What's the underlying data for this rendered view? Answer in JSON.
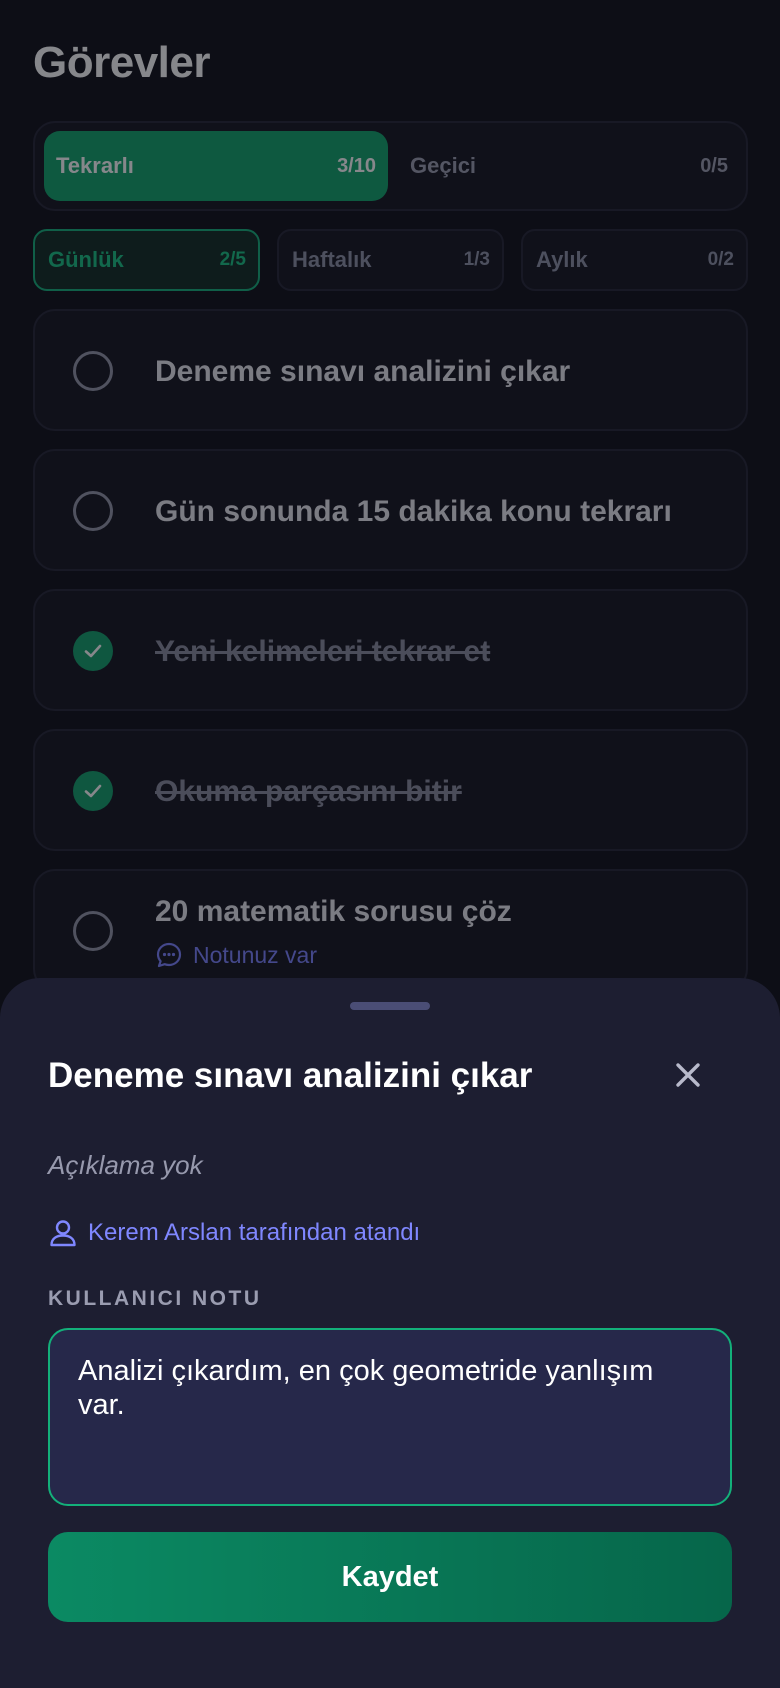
{
  "page": {
    "title": "Görevler"
  },
  "segments": [
    {
      "label": "Tekrarlı",
      "count": "3/10"
    },
    {
      "label": "Geçici",
      "count": "0/5"
    }
  ],
  "periods": [
    {
      "label": "Günlük",
      "count": "2/5"
    },
    {
      "label": "Haftalık",
      "count": "1/3"
    },
    {
      "label": "Aylık",
      "count": "0/2"
    }
  ],
  "tasks": [
    {
      "text": "Deneme sınavı analizini çıkar",
      "done": false
    },
    {
      "text": "Gün sonunda 15 dakika konu tekrarı",
      "done": false
    },
    {
      "text": "Yeni kelimeleri tekrar et",
      "done": true
    },
    {
      "text": "Okuma parçasını bitir",
      "done": true
    },
    {
      "text": "20 matematik sorusu çöz",
      "done": false,
      "note": "Notunuz var"
    }
  ],
  "sheet": {
    "title": "Deneme sınavı analizini çıkar",
    "description": "Açıklama yok",
    "assigned_by": "Kerem Arslan tarafından atandı",
    "note_label": "KULLANICI NOTU",
    "note_value": "Analizi çıkardım, en çok geometride yanlışım var.",
    "save_label": "Kaydet"
  },
  "colors": {
    "accent": "#0fa36b",
    "link": "#7f87ff",
    "sheet_bg": "#1d1e31",
    "page_bg": "#0d0e16"
  }
}
